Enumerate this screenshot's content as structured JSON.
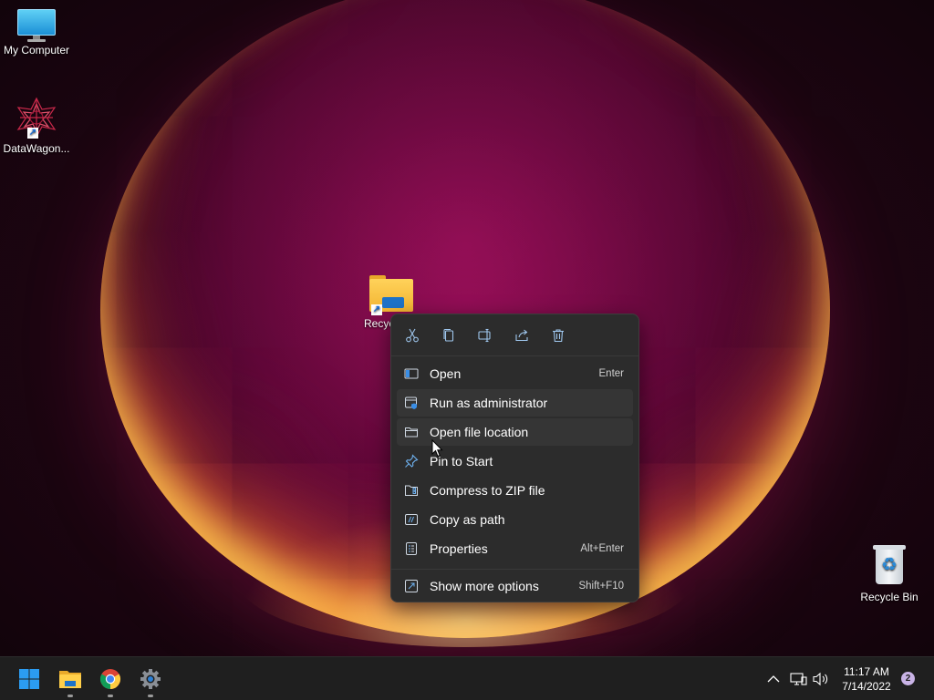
{
  "desktop": {
    "icons": [
      {
        "label": "My Computer",
        "icon": "monitor-icon"
      },
      {
        "label": "DataWagon...",
        "icon": "datawagon-app-icon"
      },
      {
        "label": "Recyc",
        "icon": "folder-shortcut-icon"
      },
      {
        "label": "Recycle Bin",
        "icon": "recycle-bin-icon"
      }
    ]
  },
  "context_menu": {
    "quick_actions": [
      "cut-icon",
      "copy-icon",
      "rename-icon",
      "share-icon",
      "delete-icon"
    ],
    "items": [
      {
        "label": "Open",
        "shortcut": "Enter",
        "icon": "open-icon"
      },
      {
        "label": "Run as administrator",
        "shortcut": "",
        "icon": "admin-shield-icon"
      },
      {
        "label": "Open file location",
        "shortcut": "",
        "icon": "folder-icon"
      },
      {
        "label": "Pin to Start",
        "shortcut": "",
        "icon": "pin-icon"
      },
      {
        "label": "Compress to ZIP file",
        "shortcut": "",
        "icon": "zip-icon"
      },
      {
        "label": "Copy as path",
        "shortcut": "",
        "icon": "copy-path-icon"
      },
      {
        "label": "Properties",
        "shortcut": "Alt+Enter",
        "icon": "properties-icon"
      },
      {
        "label": "Show more options",
        "shortcut": "Shift+F10",
        "icon": "more-options-icon"
      }
    ]
  },
  "taskbar": {
    "apps": [
      "start-icon",
      "file-explorer-icon",
      "chrome-icon",
      "settings-icon"
    ],
    "tray": [
      "chevron-up-icon",
      "network-icon",
      "volume-icon"
    ],
    "time": "11:17 AM",
    "date": "7/14/2022",
    "notification_count": "2"
  },
  "colors": {
    "menu_bg": "#2c2c2c",
    "taskbar_bg": "#1f1f1f",
    "accent": "#0078d4"
  }
}
